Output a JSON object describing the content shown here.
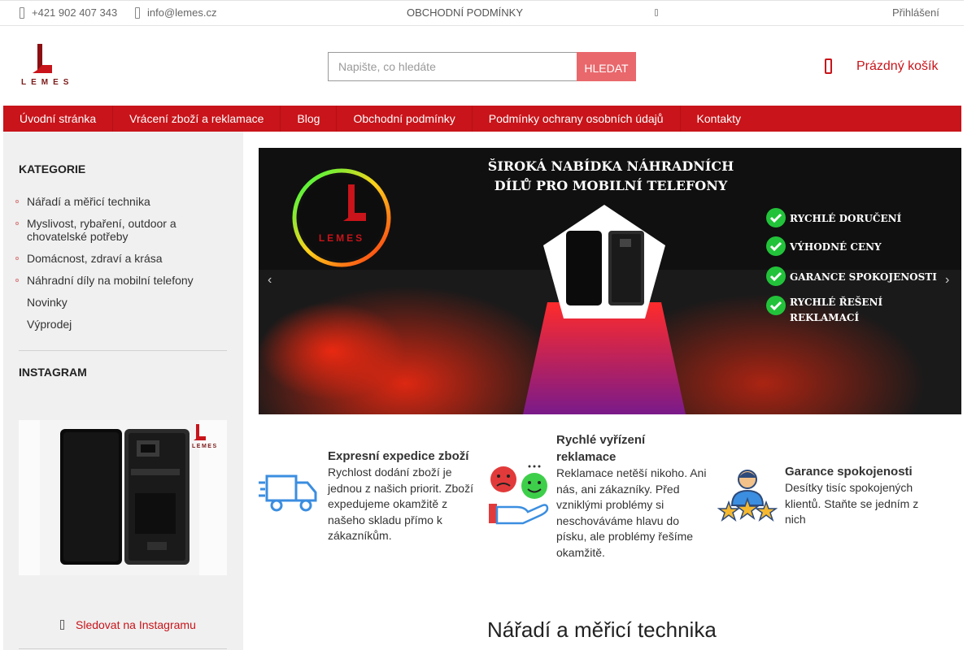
{
  "topbar": {
    "phone": "+421 902 407 343",
    "email": "info@lemes.cz",
    "terms": "OBCHODNÍ PODMÍNKY",
    "login": "Přihlášení",
    "icons": [
      "phone-icon",
      "mail-icon",
      "settings-icon"
    ]
  },
  "logo": {
    "text": "LEMES",
    "color": "#c8141a"
  },
  "search": {
    "placeholder": "Napište, co hledáte",
    "button_label": "HLEDAT"
  },
  "cart": {
    "label": "Prázdný košík"
  },
  "nav": {
    "items": [
      "Úvodní stránka",
      "Vrácení zboží a reklamace",
      "Blog",
      "Obchodní podmínky",
      "Podmínky ochrany osobních údajů",
      "Kontakty"
    ]
  },
  "sidebar": {
    "categories_heading": "KATEGORIE",
    "categories": [
      "Nářadí a měřicí technika",
      "Myslivost, rybaření, outdoor a chovatelské potřeby",
      "Domácnost, zdraví a krása",
      "Náhradní díly na mobilní telefony",
      "Novinky",
      "Výprodej"
    ],
    "instagram_heading": "INSTAGRAM",
    "instagram_logo": "LEMES",
    "instagram_follow": "Sledovat na Instagramu"
  },
  "banner": {
    "headline_1": "ŠIROKÁ NABÍDKA NÁHRADNÍCH",
    "headline_2": "DÍLŮ PRO MOBILNÍ TELEFONY",
    "logo": "LEMES",
    "benefits": [
      "RYCHLÉ DORUČENÍ",
      "VÝHODNÉ CENY",
      "GARANCE SPOKOJENOSTI",
      "RYCHLÉ ŘEŠENÍ",
      "REKLAMACÍ"
    ]
  },
  "features": [
    {
      "title": "Expresní expedice zboží",
      "text": "Rychlost dodání zboží je jednou z našich priorit. Zboží expedujeme okamžitě z našeho skladu přímo k zákazníkům.",
      "icon": "delivery-truck-icon"
    },
    {
      "title": "Rychlé vyřízení reklamace",
      "text": "Reklamace netěší nikoho. Ani nás, ani zákazníky. Před vzniklými problémy si neschováváme hlavu do písku, ale problémy řešíme okamžitě.",
      "icon": "satisfaction-hand-icon"
    },
    {
      "title": "Garance spokojenosti",
      "text": "Desítky tisíc spokojených klientů. Staňte se jedním z nich",
      "icon": "rating-stars-icon"
    }
  ],
  "section": {
    "title": "Nářadí a měřicí technika"
  },
  "colors": {
    "brand_red": "#c8141a",
    "search_button": "#e9686c",
    "sidebar_bg": "#f0f0f0"
  }
}
